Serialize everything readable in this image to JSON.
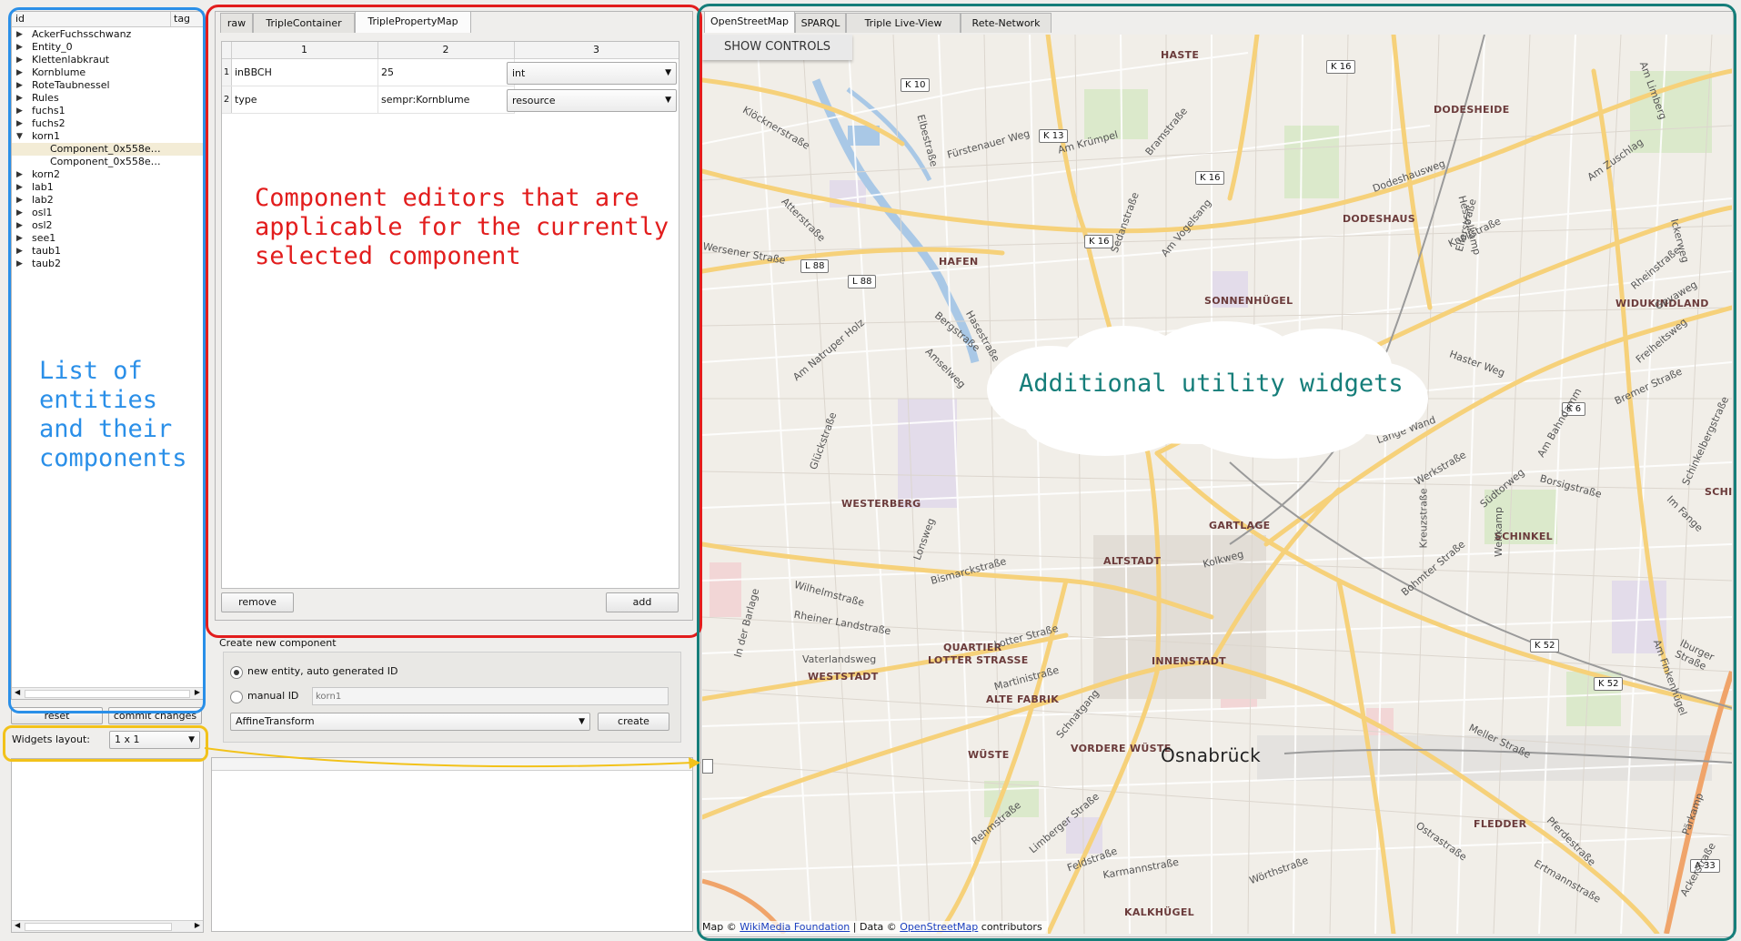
{
  "tree": {
    "col_id": "id",
    "col_tag": "tag",
    "items": [
      {
        "label": "AckerFuchsschwanz",
        "expand": "▶"
      },
      {
        "label": "Entity_0",
        "expand": "▶"
      },
      {
        "label": "Klettenlabkraut",
        "expand": "▶"
      },
      {
        "label": "Kornblume",
        "expand": "▶"
      },
      {
        "label": "RoteTaubnessel",
        "expand": "▶"
      },
      {
        "label": "Rules",
        "expand": "▶"
      },
      {
        "label": "fuchs1",
        "expand": "▶"
      },
      {
        "label": "fuchs2",
        "expand": "▶"
      },
      {
        "label": "korn1",
        "expand": "▼"
      },
      {
        "label": "Component_0x558e…",
        "expand": ""
      },
      {
        "label": "Component_0x558e…",
        "expand": ""
      },
      {
        "label": "korn2",
        "expand": "▶"
      },
      {
        "label": "lab1",
        "expand": "▶"
      },
      {
        "label": "lab2",
        "expand": "▶"
      },
      {
        "label": "osl1",
        "expand": "▶"
      },
      {
        "label": "osl2",
        "expand": "▶"
      },
      {
        "label": "see1",
        "expand": "▶"
      },
      {
        "label": "taub1",
        "expand": "▶"
      },
      {
        "label": "taub2",
        "expand": "▶"
      }
    ],
    "reset_label": "reset",
    "commit_label": "commit changes",
    "widgets_layout_label": "Widgets layout:",
    "widgets_layout_value": "1 x 1"
  },
  "editor": {
    "tabs": [
      "raw",
      "TripleContainer",
      "TriplePropertyMap"
    ],
    "columns": [
      "1",
      "2",
      "3"
    ],
    "rows": [
      {
        "num": "1",
        "key": "inBBCH",
        "value": "25",
        "type": "int"
      },
      {
        "num": "2",
        "key": "type",
        "value": "sempr:Kornblume",
        "type": "resource"
      }
    ],
    "remove_label": "remove",
    "add_label": "add"
  },
  "create": {
    "title": "Create new component",
    "radio_auto": "new entity, auto generated ID",
    "radio_manual": "manual ID",
    "manual_placeholder": "korn1",
    "component_type": "AffineTransform",
    "create_label": "create"
  },
  "utility": {
    "tabs": [
      "OpenStreetMap",
      "SPARQL",
      "Triple Live-View",
      "Rete-Network"
    ],
    "show_controls": "SHOW CONTROLS",
    "attrib_prefix": "Map © ",
    "attrib_link1": "WikiMedia Foundation",
    "attrib_mid": " | Data © ",
    "attrib_link2": "OpenStreetMap",
    "attrib_suffix": " contributors"
  },
  "map_labels": {
    "city": "Osnabrück",
    "districts": [
      "HASTE",
      "DODESHEIDE",
      "DODESHAUS",
      "HAFEN",
      "SONNENHÜGEL",
      "WIDUKINDLAND",
      "WESTERBERG",
      "GARTLAGE",
      "SCHINKEL",
      "ALTSTADT",
      "QUARTIER",
      "LOTTER STRASSE",
      "INNENSTADT",
      "WESTSTADT",
      "ALTE FABRIK",
      "WÜSTE",
      "VORDERE WÜSTE",
      "FLEDDER",
      "KALKHÜGEL",
      "SCHIN"
    ],
    "roads": [
      "K 10",
      "K 16",
      "K 13",
      "K 16",
      "K 16",
      "L 88",
      "L 88",
      "K 6",
      "K 52",
      "K 52",
      "A 33"
    ],
    "streets": [
      "Klöcknerstraße",
      "Fürstenauer Weg",
      "Am Krümpel",
      "Bramstraße",
      "Dodeshausweg",
      "Knollstraße",
      "Am Zuschlag",
      "Am Limberg",
      "Elbestraße",
      "Atterstraße",
      "Wersener Straße",
      "Am Natruper Holz",
      "Bergstraße",
      "Haster Weg",
      "Gevaweg",
      "Freiheitsweg",
      "Bremer Straße",
      "Lange Wand",
      "Werkstraße",
      "Südtorweg",
      "Borsigstraße",
      "Am Bahndamm",
      "Glückstraße",
      "Lonsweg",
      "Bismarckstraße",
      "Wilhelmstraße",
      "Rheiner Landstraße",
      "Lotter Straße",
      "Martinistraße",
      "Schnatgang",
      "Rehmstraße",
      "Limberger Straße",
      "Feldstraße",
      "Karmannstraße",
      "Meller Straße",
      "Pferdestraße",
      "Ertmannstraße",
      "Ostrastraße",
      "Kreuzstraße",
      "Weitkamp",
      "Iburger Straße",
      "Am Finkenhügel",
      "In der Barlage",
      "Vaterlandsweg",
      "Rheinstraße",
      "Hasestraße",
      "Amselweg",
      "Am Vogelsang",
      "Sedanstraße",
      "Ackerstraße",
      "Pärkamp",
      "Im Fange",
      "Schinkelbergstraße",
      "Bohmter Straße",
      "Wörthstraße",
      "Hesselkamp",
      "Ellerstraße",
      "Ickerweg",
      "Kolkweg"
    ]
  },
  "annotations": {
    "left": "List of\nentities\nand their\ncomponents",
    "middle": "Component editors that are\napplicable for the currently\nselected component",
    "right": "Additional utility widgets"
  },
  "colors": {
    "left_box": "#2a8fe8",
    "middle_box": "#e21d1d",
    "right_box": "#167e7a",
    "layout_box": "#f2c21a",
    "link": "#1a3fbf"
  }
}
